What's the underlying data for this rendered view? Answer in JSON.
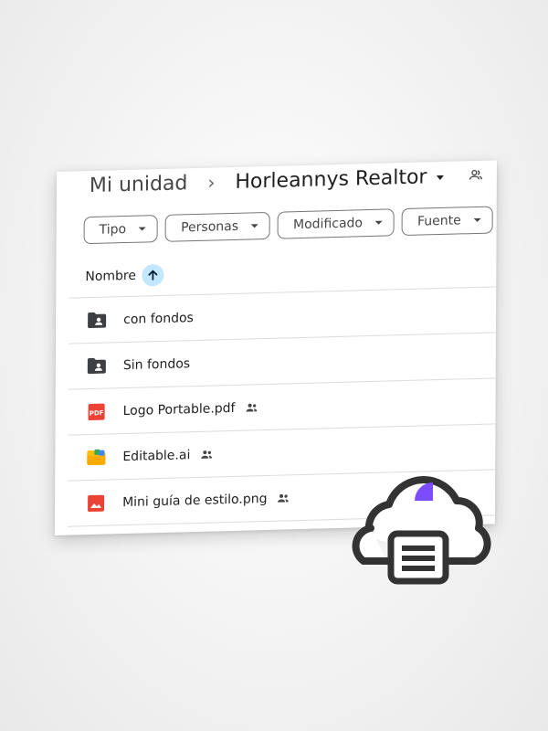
{
  "breadcrumb": {
    "root": "Mi unidad",
    "separator": "›",
    "current": "Horleannys Realtor"
  },
  "filters": [
    {
      "label": "Tipo"
    },
    {
      "label": "Personas"
    },
    {
      "label": "Modificado"
    },
    {
      "label": "Fuente"
    }
  ],
  "sort": {
    "label": "Nombre",
    "direction": "ascending"
  },
  "files": [
    {
      "name": "con fondos",
      "type": "shared-folder",
      "shared": false
    },
    {
      "name": "Sin fondos",
      "type": "shared-folder",
      "shared": false
    },
    {
      "name": "Logo Portable.pdf",
      "type": "pdf",
      "icon_text": "PDF",
      "shared": true
    },
    {
      "name": "Editable.ai",
      "type": "ai-folder",
      "shared": true
    },
    {
      "name": "Mini guía de estilo.png",
      "type": "image",
      "shared": true
    }
  ],
  "colors": {
    "accent_sort": "#c2e7ff",
    "pdf_red": "#ea4335",
    "cloud_purple": "#7c4dff",
    "icon_dark": "#3c4043"
  }
}
